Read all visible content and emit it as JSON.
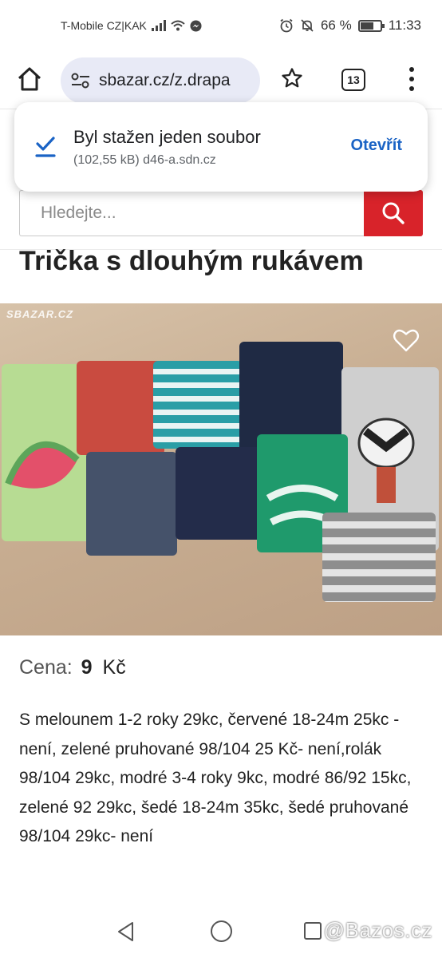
{
  "status_bar": {
    "carrier": "T-Mobile CZ|KAK",
    "battery": "66 %",
    "battery_level": 0.66,
    "time": "11:33"
  },
  "browser": {
    "url": "sbazar.cz/z.drapa",
    "tab_count": "13"
  },
  "notification": {
    "title": "Byl stažen jeden soubor",
    "subtitle": "(102,55 kB) d46-a.sdn.cz",
    "action": "Otevřít"
  },
  "search": {
    "placeholder": "Hledejte..."
  },
  "listing": {
    "title": "Trička s dlouhým rukávem",
    "watermark": "SBAZAR.CZ",
    "price_label": "Cena:",
    "price_value": "9",
    "price_currency": "Kč",
    "description": "S melounem 1-2 roky 29kc, červené 18-24m 25kc - není, zelené pruhované 98/104 25 Kč- není,rolák 98/104 29kc, modré 3-4 roky 9kc, modré 86/92 15kc, zelené 92 29kc, šedé 18-24m 35kc, šedé pruhované 98/104 29kc- není"
  },
  "overlay": {
    "site_mark": "@Bazos.cz"
  },
  "colors": {
    "accent_red": "#d8232a",
    "link_blue": "#1a63c5",
    "url_pill": "#e8eaf6"
  }
}
